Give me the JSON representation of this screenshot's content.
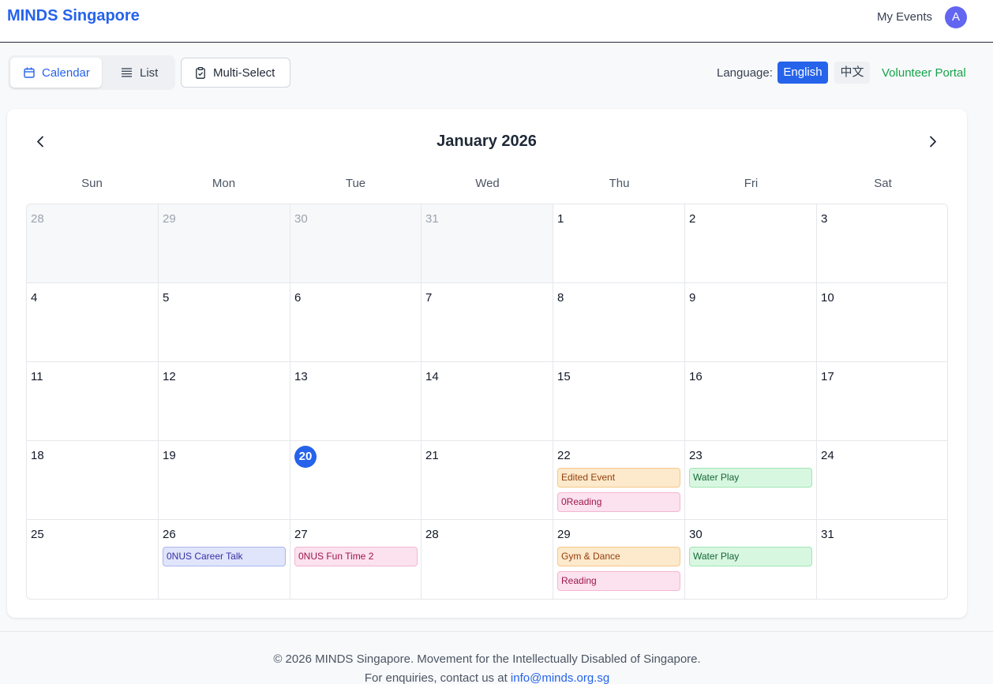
{
  "header": {
    "brand": "MINDS Singapore",
    "my_events": "My Events",
    "avatar_initial": "A"
  },
  "toolbar": {
    "calendar_label": "Calendar",
    "list_label": "List",
    "multi_select_label": "Multi-Select",
    "active_view": "Calendar",
    "language_label": "Language:",
    "lang_en": "English",
    "lang_zh": "中文",
    "active_language": "English",
    "volunteer_portal": "Volunteer Portal"
  },
  "calendar": {
    "month_title": "January 2026",
    "days_of_week": [
      "Sun",
      "Mon",
      "Tue",
      "Wed",
      "Thu",
      "Fri",
      "Sat"
    ],
    "today": "20",
    "weeks": [
      [
        {
          "day": "28",
          "other": true,
          "events": []
        },
        {
          "day": "29",
          "other": true,
          "events": []
        },
        {
          "day": "30",
          "other": true,
          "events": []
        },
        {
          "day": "31",
          "other": true,
          "events": []
        },
        {
          "day": "1",
          "events": []
        },
        {
          "day": "2",
          "events": []
        },
        {
          "day": "3",
          "events": []
        }
      ],
      [
        {
          "day": "4",
          "events": []
        },
        {
          "day": "5",
          "events": []
        },
        {
          "day": "6",
          "events": []
        },
        {
          "day": "7",
          "events": []
        },
        {
          "day": "8",
          "events": []
        },
        {
          "day": "9",
          "events": []
        },
        {
          "day": "10",
          "events": []
        }
      ],
      [
        {
          "day": "11",
          "events": []
        },
        {
          "day": "12",
          "events": []
        },
        {
          "day": "13",
          "events": []
        },
        {
          "day": "14",
          "events": []
        },
        {
          "day": "15",
          "events": []
        },
        {
          "day": "16",
          "events": []
        },
        {
          "day": "17",
          "events": []
        }
      ],
      [
        {
          "day": "18",
          "events": []
        },
        {
          "day": "19",
          "events": []
        },
        {
          "day": "20",
          "today": true,
          "events": []
        },
        {
          "day": "21",
          "events": []
        },
        {
          "day": "22",
          "events": [
            {
              "title": "Edited Event",
              "color": "orange"
            },
            {
              "title": "0Reading",
              "color": "pink"
            }
          ]
        },
        {
          "day": "23",
          "events": [
            {
              "title": "Water Play",
              "color": "green"
            }
          ]
        },
        {
          "day": "24",
          "events": []
        }
      ],
      [
        {
          "day": "25",
          "events": []
        },
        {
          "day": "26",
          "events": [
            {
              "title": "0NUS Career Talk",
              "color": "blue"
            }
          ]
        },
        {
          "day": "27",
          "events": [
            {
              "title": "0NUS Fun Time 2",
              "color": "pink"
            }
          ]
        },
        {
          "day": "28",
          "events": []
        },
        {
          "day": "29",
          "events": [
            {
              "title": "Gym & Dance",
              "color": "orange"
            },
            {
              "title": "Reading",
              "color": "pink"
            }
          ]
        },
        {
          "day": "30",
          "events": [
            {
              "title": "Water Play",
              "color": "green"
            }
          ]
        },
        {
          "day": "31",
          "events": []
        }
      ]
    ]
  },
  "footer": {
    "line1": "© 2026 MINDS Singapore. Movement for the Intellectually Disabled of Singapore.",
    "line2_prefix": "For enquiries, contact us at ",
    "email": "info@minds.org.sg"
  },
  "colors": {
    "accent": "#2563eb",
    "volunteer_green": "#16a34a",
    "avatar": "#6366f1"
  },
  "icons": {
    "calendar_view": "calendar-icon",
    "list_view": "list-icon",
    "multi_select": "clipboard-icon",
    "prev_month": "chevron-left-icon",
    "next_month": "chevron-right-icon"
  }
}
